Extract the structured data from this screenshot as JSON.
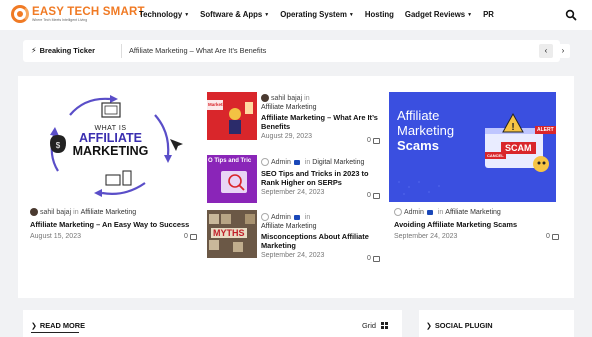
{
  "logo": {
    "title": "EASY TECH SMART",
    "tagline": "Where Tech Meets Intelligent Living"
  },
  "nav": {
    "items": [
      {
        "label": "Technology",
        "dropdown": true
      },
      {
        "label": "Software & Apps",
        "dropdown": true
      },
      {
        "label": "Operating System",
        "dropdown": true
      },
      {
        "label": "Hosting",
        "dropdown": false
      },
      {
        "label": "Gadget Reviews",
        "dropdown": true
      },
      {
        "label": "PR",
        "dropdown": false
      }
    ],
    "search_icon": "search-icon"
  },
  "ticker": {
    "label": "Breaking Ticker",
    "text": "Affiliate Marketing – What Are It’s Benefits",
    "prev": "‹",
    "next": "›"
  },
  "featured": {
    "big": {
      "image_text_small": "WHAT IS",
      "image_text_1": "AFFILIATE",
      "image_text_2": "MARKETING",
      "author": "sahil bajaj",
      "in": "in",
      "category": "Affiliate Marketing",
      "title": "Affiliate Marketing – An Easy Way to Success",
      "date": "August 15, 2023",
      "comments": "0"
    },
    "middle": [
      {
        "author": "sahil bajaj",
        "in": "in",
        "category": "Affiliate Marketing",
        "title": "Affiliate Marketing – What Are It’s Benefits",
        "date": "August 29, 2023",
        "comments": "0",
        "thumb_color": "#d9262b",
        "thumb_text": "Marketing"
      },
      {
        "author": "Admin",
        "in": "in",
        "category": "Digital Marketing",
        "title": "SEO Tips and Tricks in 2023 to Rank Higher on SERPs",
        "date": "September 24, 2023",
        "comments": "0",
        "thumb_color": "#8a25b8",
        "thumb_text": "O Tips and Tric"
      },
      {
        "author": "Admin",
        "in": "in",
        "category": "Affiliate Marketing",
        "title": "Misconceptions About Affiliate Marketing",
        "date": "September 24, 2023",
        "comments": "0",
        "thumb_color": "#6b5846",
        "thumb_text": "MYTHS"
      }
    ],
    "right": {
      "image_text_1": "Affiliate",
      "image_text_2": "Marketing",
      "image_text_3": "Scams",
      "badge_alert": "ALERT",
      "badge_scam": "SCAM",
      "badge_cancel": "CANCEL",
      "author": "Admin",
      "in": "in",
      "category": "Affiliate Marketing",
      "title": "Avoiding Affiliate Marketing Scams",
      "date": "September 24, 2023",
      "comments": "0"
    }
  },
  "read_more": {
    "label": "READ MORE",
    "grid_label": "Grid"
  },
  "social": {
    "label": "SOCIAL PLUGIN"
  },
  "colors": {
    "brand": "#f07a24",
    "accent_blue": "#3a4fe0"
  }
}
